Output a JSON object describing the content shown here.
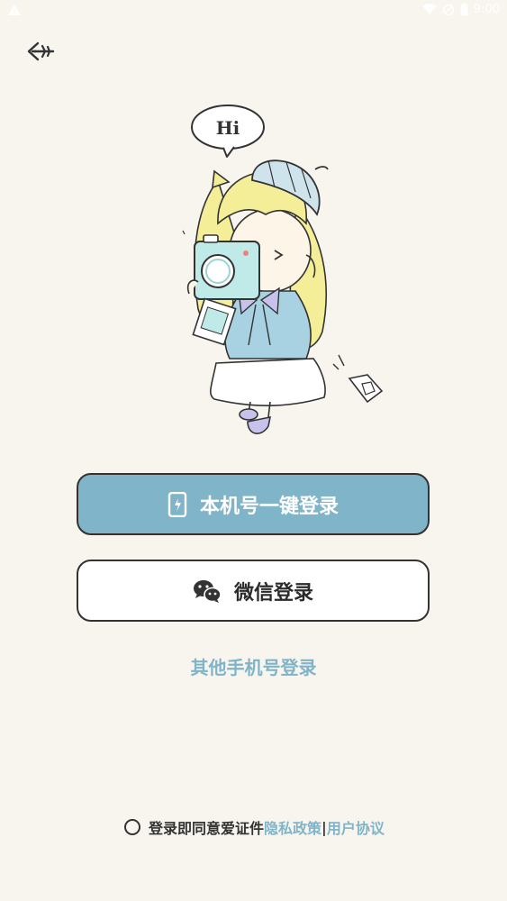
{
  "status_bar": {
    "time": "9:00"
  },
  "illustration": {
    "speech_text": "Hi"
  },
  "buttons": {
    "one_click": "本机号一键登录",
    "wechat": "微信登录"
  },
  "other_login": "其他手机号登录",
  "agreement": {
    "prefix": "登录即同意爱证件",
    "privacy": "隐私政策",
    "separator": "|",
    "terms": "用户协议"
  },
  "colors": {
    "background": "#F8F5EF",
    "accent": "#7FB4C9",
    "border": "#333333"
  }
}
